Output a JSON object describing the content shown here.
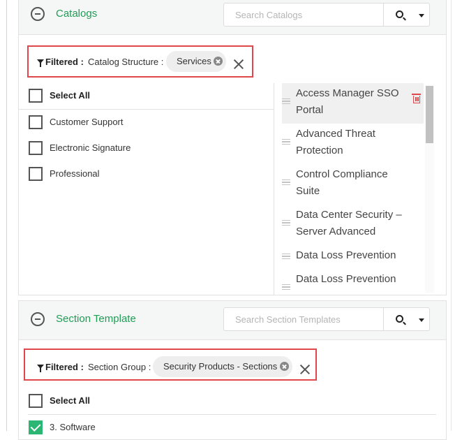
{
  "catalogs": {
    "title": "Catalogs",
    "search_placeholder": "Search Catalogs",
    "filter": {
      "label": "Filtered :",
      "field": "Catalog Structure :",
      "chip": "Services"
    },
    "select_all": "Select All",
    "items": [
      {
        "label": "Customer Support",
        "checked": false
      },
      {
        "label": "Electronic Signature",
        "checked": false
      },
      {
        "label": "Professional",
        "checked": false
      }
    ],
    "selected_items": [
      {
        "label": "Access Manager SSO Portal",
        "active": true
      },
      {
        "label": "Advanced Threat Protection",
        "active": false
      },
      {
        "label": "Control Compliance Suite",
        "active": false
      },
      {
        "label": "Data Center Security – Server Advanced",
        "active": false
      },
      {
        "label": "Data Loss Prevention",
        "active": false
      },
      {
        "label": "Data Loss Prevention",
        "active": false
      }
    ]
  },
  "section_template": {
    "title": "Section Template",
    "search_placeholder": "Search Section Templates",
    "filter": {
      "label": "Filtered :",
      "field": "Section Group :",
      "chip": "Security Products - Sections"
    },
    "select_all": "Select All",
    "items": [
      {
        "label": "3. Software",
        "checked": true
      }
    ]
  },
  "icons": {
    "collapse": "minus-circle-icon",
    "search": "search-icon",
    "dropdown": "caret-down-icon",
    "filter": "funnel-icon",
    "chip_remove": "x-circle-icon",
    "clear": "close-icon",
    "drag": "drag-handle-icon",
    "delete": "trash-icon"
  },
  "colors": {
    "title_green": "#1f9d55",
    "highlight_red": "#e0474c",
    "checked_green": "#2bb673"
  }
}
